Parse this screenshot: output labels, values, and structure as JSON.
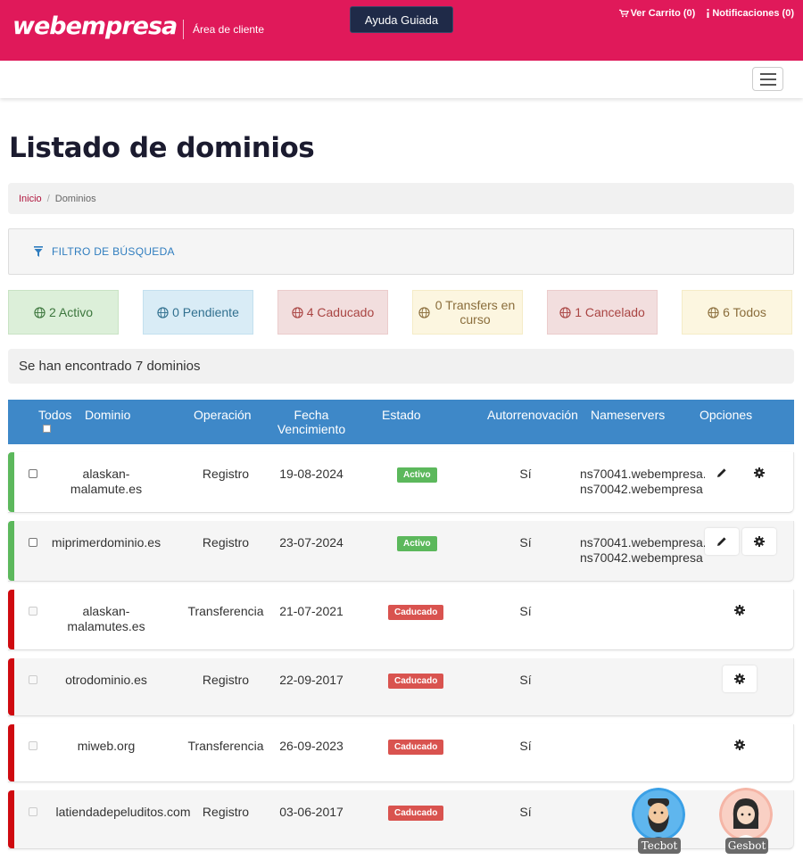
{
  "header": {
    "logo": "webempresa",
    "area": "Área de cliente",
    "help_button": "Ayuda Guiada",
    "cart_link": "Ver Carrito (0)",
    "notifications_link": "Notificaciones (0)"
  },
  "page": {
    "title": "Listado de dominios"
  },
  "breadcrumb": {
    "home": "Inicio",
    "separator": "/",
    "current": "Dominios"
  },
  "filter": {
    "label": "FILTRO DE BÚSQUEDA"
  },
  "status_filters": [
    {
      "label": "2 Activo"
    },
    {
      "label": "0 Pendiente"
    },
    {
      "label": "4 Caducado"
    },
    {
      "label": "0 Transfers en curso"
    },
    {
      "label": "1 Cancelado"
    },
    {
      "label": "6 Todos"
    }
  ],
  "results": {
    "summary": "Se han encontrado 7 dominios"
  },
  "table": {
    "headers": {
      "todos": "Todos",
      "dominio": "Dominio",
      "operacion": "Operación",
      "fecha_1": "Fecha",
      "fecha_2": "Vencimiento",
      "estado": "Estado",
      "autorrenovacion": "Autorrenovación",
      "nameservers": "Nameservers",
      "opciones": "Opciones"
    },
    "rows": [
      {
        "domain_1": "alaskan-",
        "domain_2": "malamute.es",
        "operation": "Registro",
        "expiry": "19-08-2024",
        "status": "Activo",
        "autorenew": "Sí",
        "ns1": "ns70041.webempresa.",
        "ns2": "ns70042.webempresa"
      },
      {
        "domain_1": "miprimerdominio.es",
        "domain_2": "",
        "operation": "Registro",
        "expiry": "23-07-2024",
        "status": "Activo",
        "autorenew": "Sí",
        "ns1": "ns70041.webempresa.",
        "ns2": "ns70042.webempresa"
      },
      {
        "domain_1": "alaskan-",
        "domain_2": "malamutes.es",
        "operation": "Transferencia",
        "expiry": "21-07-2021",
        "status": "Caducado",
        "autorenew": "Sí",
        "ns1": "",
        "ns2": ""
      },
      {
        "domain_1": "otrodominio.es",
        "domain_2": "",
        "operation": "Registro",
        "expiry": "22-09-2017",
        "status": "Caducado",
        "autorenew": "Sí",
        "ns1": "",
        "ns2": ""
      },
      {
        "domain_1": "miweb.org",
        "domain_2": "",
        "operation": "Transferencia",
        "expiry": "26-09-2023",
        "status": "Caducado",
        "autorenew": "Sí",
        "ns1": "",
        "ns2": ""
      },
      {
        "domain_1": "latiendadepeluditos.com",
        "domain_2": "",
        "operation": "Registro",
        "expiry": "03-06-2017",
        "status": "Caducado",
        "autorenew": "Sí",
        "ns1": "",
        "ns2": ""
      }
    ]
  },
  "bots": {
    "tecbot": "Tecbot",
    "gesbot": "Gesbot"
  },
  "colors": {
    "brand": "#e0195a",
    "table_header": "#3e88c8",
    "active": "#5cb85c",
    "expired": "#d9534f",
    "expired_bar": "#cf0a10",
    "help_button": "#1f2a48"
  }
}
